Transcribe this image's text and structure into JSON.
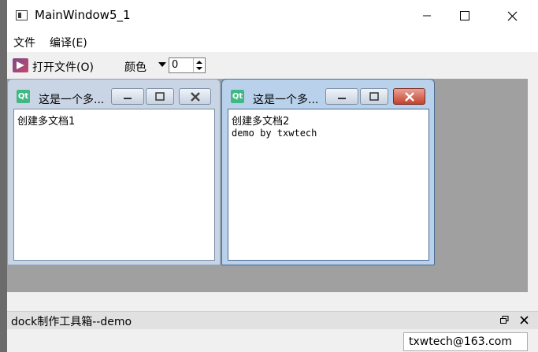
{
  "window": {
    "title": "MainWindow5_1"
  },
  "menu": {
    "items": [
      "文件",
      "编译(E)"
    ]
  },
  "toolbar": {
    "open_label": "打开文件(O)",
    "color_label": "颜色",
    "spin_value": "0"
  },
  "mdi": {
    "subwindows": [
      {
        "title": "这是一个多...",
        "lines": [
          "创建多文档1"
        ]
      },
      {
        "title": "这是一个多...",
        "lines": [
          "创建多文档2",
          "demo by txwtech"
        ]
      }
    ]
  },
  "dock": {
    "title": "dock制作工具箱--demo",
    "field_value": "txwtech@163.com"
  },
  "colors": {
    "mdi_background": "#a0a0a0",
    "close_active": "#c4432e"
  },
  "icons": [
    "app-icon",
    "minimize-icon",
    "maximize-icon",
    "close-icon",
    "qt-icon",
    "dropdown-arrow-icon",
    "restore-icon"
  ]
}
